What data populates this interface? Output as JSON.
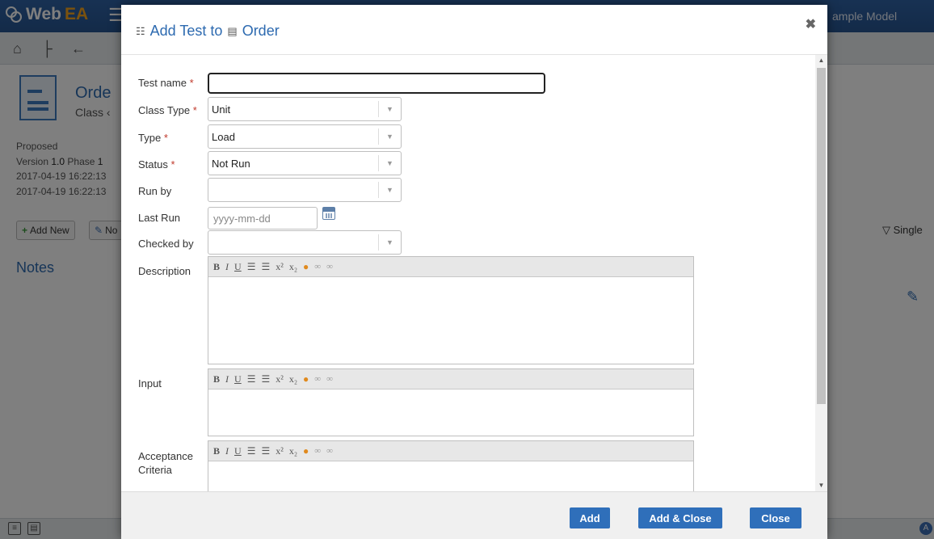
{
  "app": {
    "logo_text": "Web",
    "logo_accent": "EA",
    "model_name": "ample Model",
    "element": {
      "name": "Orde",
      "type_label": "Class ‹"
    },
    "meta": {
      "status": "Proposed",
      "version_label": "Version",
      "version": "1.0",
      "phase_label": "Phase",
      "phase": "1",
      "created": "2017-04-19 16:22:13",
      "modified": "2017-04-19 16:22:13"
    },
    "toolbar": {
      "add_new": "Add New",
      "note_btn": "No"
    },
    "notes_heading": "Notes",
    "filter_label": "Single"
  },
  "dialog": {
    "title_prefix": "Add Test to",
    "title_target": "Order",
    "close_glyph": "✖",
    "fields": {
      "test_name": {
        "label": "Test name",
        "value": ""
      },
      "class_type": {
        "label": "Class Type",
        "value": "Unit"
      },
      "type": {
        "label": "Type",
        "value": "Load"
      },
      "status": {
        "label": "Status",
        "value": "Not Run"
      },
      "run_by": {
        "label": "Run by",
        "value": ""
      },
      "last_run": {
        "label": "Last Run",
        "placeholder": "yyyy-mm-dd"
      },
      "checked_by": {
        "label": "Checked by",
        "value": ""
      },
      "description": {
        "label": "Description"
      },
      "input": {
        "label": "Input"
      },
      "acceptance_line1": "Acceptance",
      "acceptance_line2": "Criteria"
    },
    "required_marker": "*",
    "editor_toolbar": {
      "bold": "B",
      "italic": "I",
      "underline": "U",
      "ordered_list": "☰",
      "bullet_list": "☰",
      "superscript": "x²",
      "subscript": "x₂",
      "color": "●",
      "link": "∞",
      "unlink": "∞"
    },
    "buttons": {
      "add": "Add",
      "add_close": "Add & Close",
      "close": "Close"
    }
  },
  "colors": {
    "accent": "#2f6fba",
    "header": "#2f63a6",
    "required": "#c0392b"
  }
}
